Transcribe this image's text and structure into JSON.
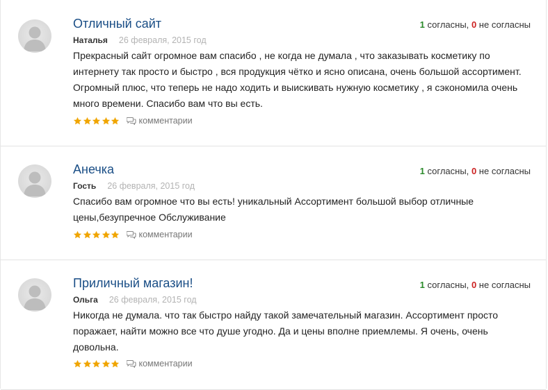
{
  "reviews": [
    {
      "title": "Отличный сайт",
      "author": "Наталья",
      "date": "26 февраля, 2015 год",
      "text": "Прекрасный сайт огромное вам спасибо , не когда не думала , что заказывать косметику по интернету так просто и быстро , вся продукция чётко и ясно описана, очень большой ассортимент. Огромный плюс, что теперь не надо ходить и выискивать нужную косметику , я сэкономила очень много времени. Спасибо вам что вы есть.",
      "agree_count": "1",
      "agree_label": "согласны,",
      "disagree_count": "0",
      "disagree_label": "не согласны",
      "rating": 5,
      "comments_label": "комментарии"
    },
    {
      "title": "Анечка",
      "author": "Гость",
      "date": "26 февраля, 2015 год",
      "text": "Спасибо вам огромное что вы есть! уникальный Ассортимент большой выбор отличные цены,безупречное Обслуживание",
      "agree_count": "1",
      "agree_label": "согласны,",
      "disagree_count": "0",
      "disagree_label": "не согласны",
      "rating": 5,
      "comments_label": "комментарии"
    },
    {
      "title": "Приличный магазин!",
      "author": "Ольга",
      "date": "26 февраля, 2015 год",
      "text": "Никогда не думала. что так быстро найду такой замечательный магазин. Ассортимент просто поражает, найти можно все что душе угодно. Да и цены вполне приемлемы. Я очень, очень довольна.",
      "agree_count": "1",
      "agree_label": "согласны,",
      "disagree_count": "0",
      "disagree_label": "не согласны",
      "rating": 5,
      "comments_label": "комментарии"
    }
  ],
  "colors": {
    "title": "#1a4e86",
    "agree": "#2a8a2a",
    "disagree": "#cc2222",
    "star": "#f0a500",
    "date": "#b3b3b3"
  },
  "icons": {
    "avatar": "user-silhouette-icon",
    "star": "star-icon",
    "comments": "speech-bubbles-icon"
  }
}
